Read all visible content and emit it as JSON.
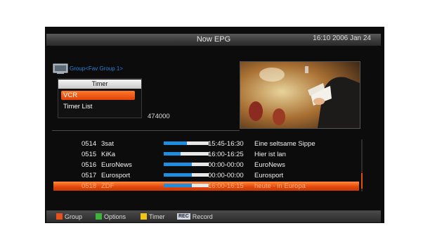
{
  "header": {
    "title": "Now EPG",
    "clock": "16:10 2006 Jan 24"
  },
  "group": {
    "label": "Group<Fav Group 1>"
  },
  "timer_menu": {
    "title": "Timer",
    "items": [
      {
        "label": "VCR"
      },
      {
        "label": "Timer List"
      }
    ]
  },
  "frequency": "474000",
  "channels": [
    {
      "num": "0514",
      "name": "3sat",
      "progress": 0.52,
      "time": "15:45-16:30",
      "program": "Eine seltsame Sippe"
    },
    {
      "num": "0515",
      "name": "KiKa",
      "progress": 0.38,
      "time": "16:00-16:25",
      "program": "Hier ist lan"
    },
    {
      "num": "0516",
      "name": "EuroNews",
      "progress": 0.62,
      "time": "00:00-00:00",
      "program": "EuroNews"
    },
    {
      "num": "0517",
      "name": "Eurosport",
      "progress": 0.62,
      "time": "00:00-00:00",
      "program": "Eurosport"
    },
    {
      "num": "0518",
      "name": "ZDF",
      "progress": 0.62,
      "time": "16:00-16:15",
      "program": "heute - in Europa"
    }
  ],
  "selected_channel_index": 4,
  "footer": {
    "keys": [
      {
        "label": "Group",
        "color": "#e8521a"
      },
      {
        "label": "Options",
        "color": "#3ab53a"
      },
      {
        "label": "Timer",
        "color": "#f0c419"
      },
      {
        "label": "Record",
        "icon": "REC",
        "icon_name": "rec-icon"
      }
    ]
  }
}
